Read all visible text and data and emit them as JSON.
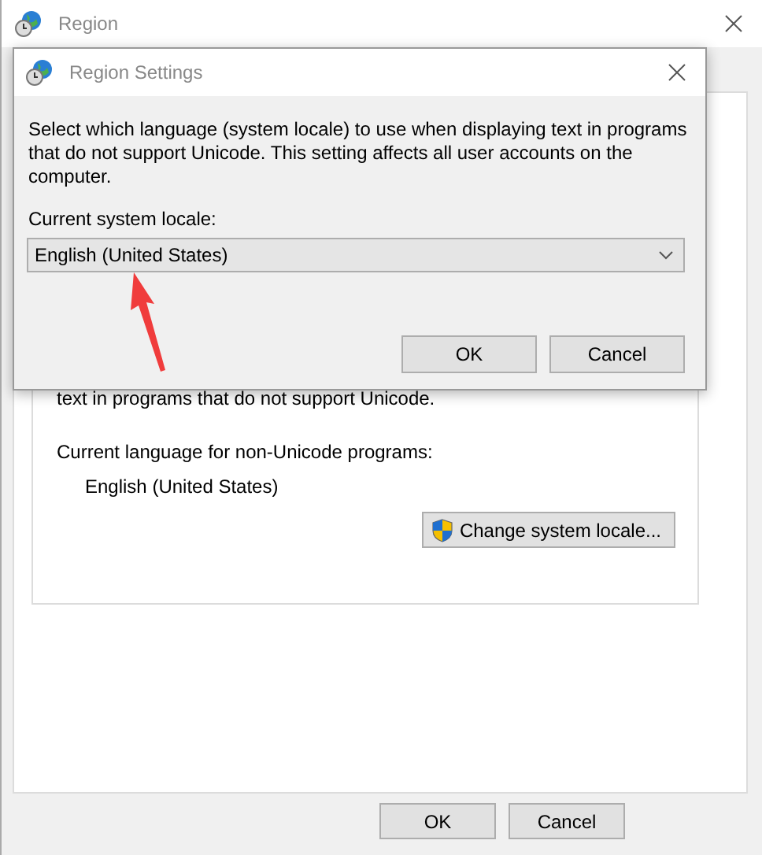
{
  "window": {
    "title": "Region"
  },
  "main": {
    "partial_text": "text in programs that do not support Unicode.",
    "current_language_label": "Current language for non-Unicode programs:",
    "current_language": "English (United States)",
    "change_button": "Change system locale..."
  },
  "buttons": [
    "OK",
    "Cancel"
  ],
  "dialog": {
    "title": "Region Settings",
    "description": "Select which language (system locale) to use when displaying text in programs that do not support Unicode. This setting affects all user accounts on the computer.",
    "locale_label": "Current system locale:",
    "locale_value": "English (United States)",
    "buttons": [
      "OK",
      "Cancel"
    ]
  },
  "annotation": {
    "kind": "arrow"
  }
}
